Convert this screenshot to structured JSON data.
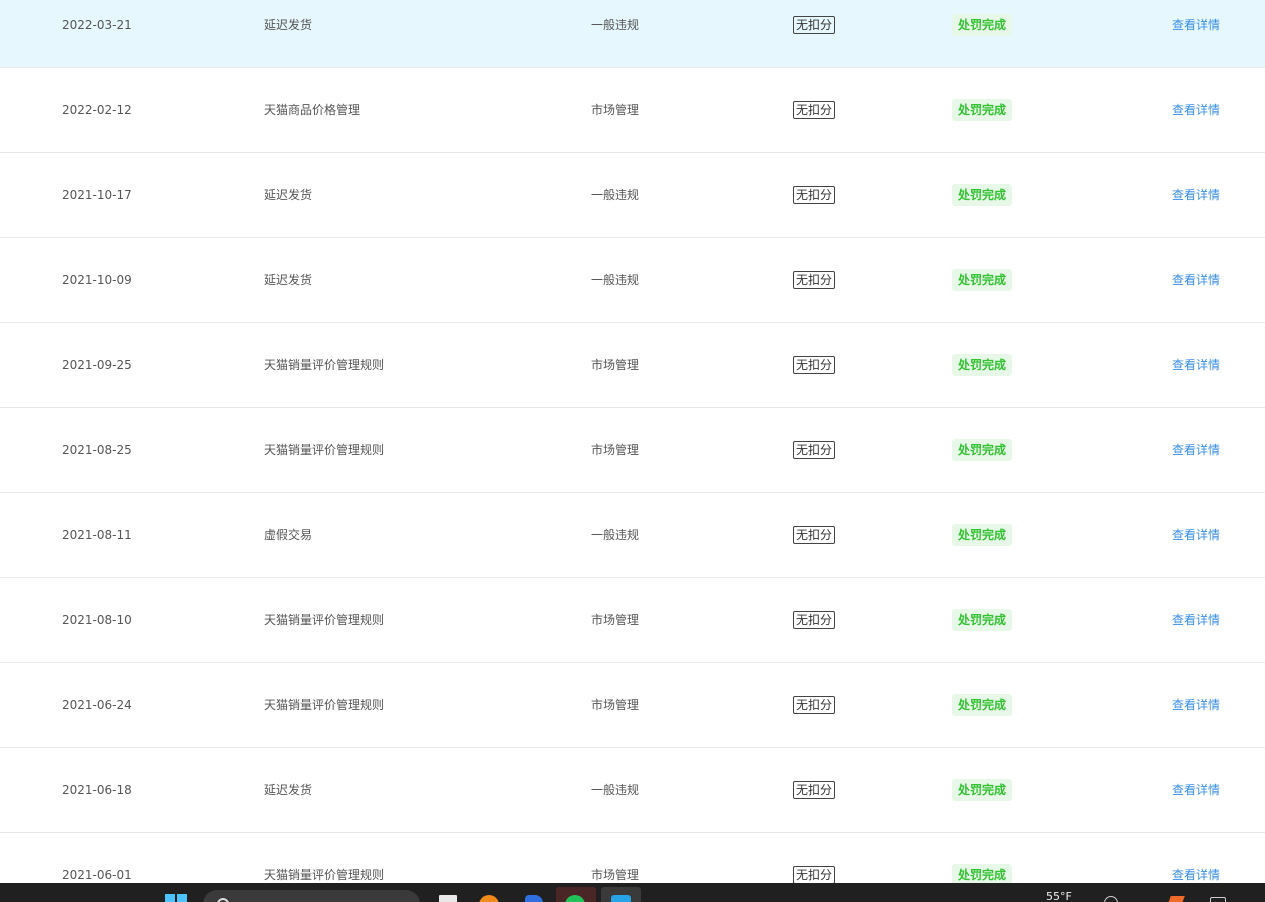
{
  "columns": [
    "date",
    "rule",
    "type",
    "score",
    "status",
    "action"
  ],
  "rows": [
    {
      "date": "2022-03-21",
      "rule": "延迟发货",
      "type": "一般违规",
      "score": "无扣分",
      "status": "处罚完成",
      "action": "查看详情",
      "selected": true
    },
    {
      "date": "2022-02-12",
      "rule": "天猫商品价格管理",
      "type": "市场管理",
      "score": "无扣分",
      "status": "处罚完成",
      "action": "查看详情",
      "selected": false
    },
    {
      "date": "2021-10-17",
      "rule": "延迟发货",
      "type": "一般违规",
      "score": "无扣分",
      "status": "处罚完成",
      "action": "查看详情",
      "selected": false
    },
    {
      "date": "2021-10-09",
      "rule": "延迟发货",
      "type": "一般违规",
      "score": "无扣分",
      "status": "处罚完成",
      "action": "查看详情",
      "selected": false
    },
    {
      "date": "2021-09-25",
      "rule": "天猫销量评价管理规则",
      "type": "市场管理",
      "score": "无扣分",
      "status": "处罚完成",
      "action": "查看详情",
      "selected": false
    },
    {
      "date": "2021-08-25",
      "rule": "天猫销量评价管理规则",
      "type": "市场管理",
      "score": "无扣分",
      "status": "处罚完成",
      "action": "查看详情",
      "selected": false
    },
    {
      "date": "2021-08-11",
      "rule": "虚假交易",
      "type": "一般违规",
      "score": "无扣分",
      "status": "处罚完成",
      "action": "查看详情",
      "selected": false
    },
    {
      "date": "2021-08-10",
      "rule": "天猫销量评价管理规则",
      "type": "市场管理",
      "score": "无扣分",
      "status": "处罚完成",
      "action": "查看详情",
      "selected": false
    },
    {
      "date": "2021-06-24",
      "rule": "天猫销量评价管理规则",
      "type": "市场管理",
      "score": "无扣分",
      "status": "处罚完成",
      "action": "查看详情",
      "selected": false
    },
    {
      "date": "2021-06-18",
      "rule": "延迟发货",
      "type": "一般违规",
      "score": "无扣分",
      "status": "处罚完成",
      "action": "查看详情",
      "selected": false
    },
    {
      "date": "2021-06-01",
      "rule": "天猫销量评价管理规则",
      "type": "市场管理",
      "score": "无扣分",
      "status": "处罚完成",
      "action": "查看详情",
      "selected": false
    }
  ],
  "colors": {
    "selected_row": "#e6f7fe",
    "status_text": "#32c232",
    "status_bg": "#e8f8e8",
    "link": "#3a8ee6"
  },
  "taskbar": {
    "weather_temp": "55°F",
    "icons": [
      "start-icon",
      "search-icon",
      "file-explorer-icon",
      "browser-icon",
      "document-icon",
      "chat-icon",
      "app-icon",
      "store-icon"
    ]
  }
}
